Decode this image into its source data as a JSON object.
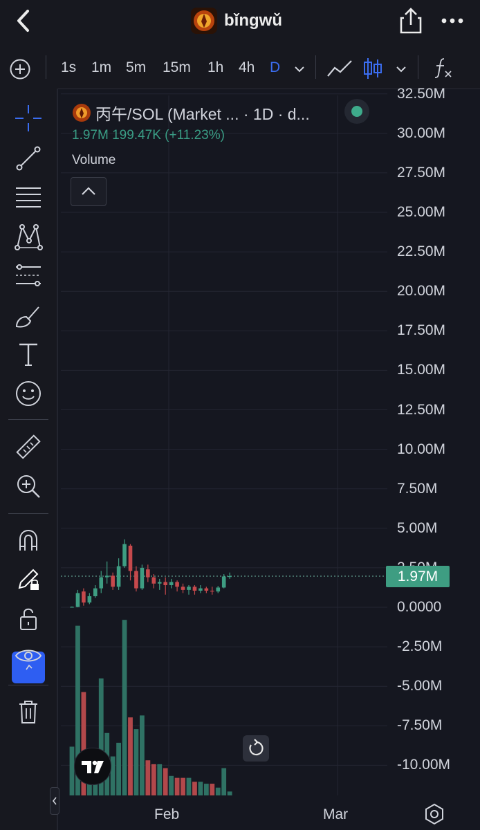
{
  "header": {
    "title": "bǐngwǔ",
    "back_icon": "chevron-left-icon",
    "share_icon": "share-icon",
    "more_icon": "more-horizontal-icon"
  },
  "toolbar": {
    "intervals": [
      "1s",
      "1m",
      "5m",
      "15m",
      "1h",
      "4h",
      "D"
    ],
    "active_interval": "D"
  },
  "legend": {
    "symbol": "丙午/SOL (Market ... · 1D · d...",
    "volume_line": "1.97M 199.47K (+11.23%)",
    "volume_label": "Volume"
  },
  "last_price_tag": "1.97M",
  "chart_data": {
    "type": "candlestick",
    "y_labels": [
      "32.50M",
      "30.00M",
      "27.50M",
      "25.00M",
      "22.50M",
      "20.00M",
      "17.50M",
      "15.00M",
      "12.50M",
      "10.00M",
      "7.50M",
      "5.00M",
      "2.50M",
      "0.0000",
      "-2.50M",
      "-5.00M",
      "-7.50M",
      "-10.00M"
    ],
    "ylim": [
      -10000000,
      32500000
    ],
    "x_labels": [
      "Feb",
      "Mar"
    ],
    "last_value": 1970000,
    "candles": [
      [
        0.0,
        0.03,
        -0.02,
        0.05,
        "up"
      ],
      [
        0.02,
        0.9,
        0.0,
        1.1,
        "up"
      ],
      [
        1.0,
        0.3,
        0.1,
        1.2,
        "down"
      ],
      [
        0.3,
        0.7,
        0.2,
        0.9,
        "up"
      ],
      [
        0.7,
        1.2,
        0.6,
        1.4,
        "up"
      ],
      [
        1.2,
        1.9,
        0.9,
        2.3,
        "up"
      ],
      [
        1.9,
        2.0,
        1.5,
        2.9,
        "up"
      ],
      [
        2.0,
        1.3,
        1.1,
        2.2,
        "down"
      ],
      [
        1.3,
        2.6,
        1.1,
        3.1,
        "up"
      ],
      [
        2.6,
        4.0,
        2.5,
        4.3,
        "up"
      ],
      [
        3.9,
        2.3,
        1.7,
        4.0,
        "down"
      ],
      [
        2.3,
        1.2,
        1.0,
        2.6,
        "down"
      ],
      [
        1.2,
        2.5,
        1.1,
        2.7,
        "up"
      ],
      [
        2.4,
        1.9,
        1.6,
        2.7,
        "down"
      ],
      [
        1.9,
        1.5,
        1.2,
        2.1,
        "down"
      ],
      [
        1.5,
        1.6,
        1.1,
        1.8,
        "up"
      ],
      [
        1.6,
        1.4,
        0.8,
        1.9,
        "down"
      ],
      [
        1.4,
        1.6,
        1.2,
        1.8,
        "up"
      ],
      [
        1.6,
        1.3,
        1.0,
        1.7,
        "down"
      ],
      [
        1.3,
        1.1,
        0.9,
        1.5,
        "down"
      ],
      [
        1.1,
        1.3,
        0.8,
        1.4,
        "up"
      ],
      [
        1.3,
        1.05,
        0.8,
        1.4,
        "down"
      ],
      [
        1.05,
        1.2,
        0.9,
        1.4,
        "up"
      ],
      [
        1.2,
        1.05,
        0.9,
        1.3,
        "down"
      ],
      [
        1.05,
        1.0,
        0.8,
        1.3,
        "down"
      ],
      [
        1.0,
        1.25,
        0.9,
        1.35,
        "up"
      ],
      [
        1.25,
        1.95,
        1.2,
        2.1,
        "up"
      ],
      [
        1.95,
        1.97,
        1.8,
        2.2,
        "up"
      ]
    ],
    "volume": [
      [
        "up",
        0.25
      ],
      [
        "up",
        0.87
      ],
      [
        "down",
        0.53
      ],
      [
        "up",
        0.2
      ],
      [
        "up",
        0.18
      ],
      [
        "up",
        0.6
      ],
      [
        "up",
        0.32
      ],
      [
        "up",
        0.2
      ],
      [
        "up",
        0.27
      ],
      [
        "up",
        0.9
      ],
      [
        "down",
        0.4
      ],
      [
        "up",
        0.34
      ],
      [
        "up",
        0.41
      ],
      [
        "down",
        0.18
      ],
      [
        "down",
        0.16
      ],
      [
        "up",
        0.16
      ],
      [
        "down",
        0.14
      ],
      [
        "up",
        0.1
      ],
      [
        "down",
        0.09
      ],
      [
        "down",
        0.09
      ],
      [
        "up",
        0.09
      ],
      [
        "down",
        0.07
      ],
      [
        "up",
        0.07
      ],
      [
        "up",
        0.06
      ],
      [
        "down",
        0.06
      ],
      [
        "up",
        0.04
      ],
      [
        "up",
        0.14
      ],
      [
        "up",
        0.02
      ]
    ],
    "up_color": "#3e9d82",
    "down_color": "#c6494c"
  }
}
